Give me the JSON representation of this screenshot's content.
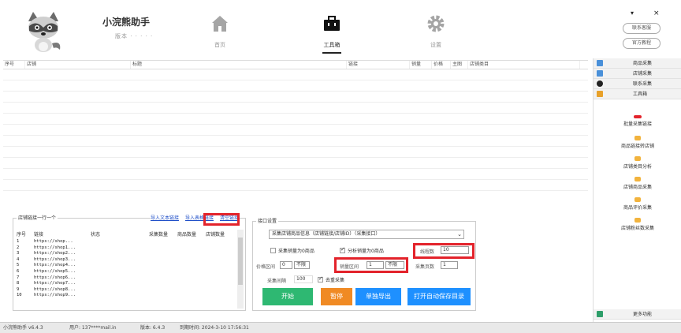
{
  "header": {
    "app_title": "小浣熊助手",
    "app_subtitle": "版本 · · · · ·",
    "nav": [
      {
        "label": "首页",
        "icon": "home-icon"
      },
      {
        "label": "工具箱",
        "icon": "toolbox-icon",
        "active": true
      },
      {
        "label": "设置",
        "icon": "gear-icon"
      }
    ],
    "right": {
      "minimize": "▾",
      "close": "×",
      "pill1": "联系客服",
      "pill2": "官方教程"
    }
  },
  "table": {
    "columns": [
      "序号",
      "店铺",
      "标题",
      "链接",
      "销量",
      "价格",
      "主图",
      "店铺类目"
    ]
  },
  "sidebar": {
    "items": [
      {
        "label": "商品采集",
        "icon": "chart-icon",
        "color": "#4a90d9"
      },
      {
        "label": "店铺采集",
        "icon": "grid-icon",
        "color": "#4a90d9"
      },
      {
        "label": "联系采集",
        "icon": "gender-icon",
        "color": "#222222"
      },
      {
        "label": "工具箱",
        "icon": "folder-icon",
        "color": "#e8a12a"
      }
    ],
    "sub_items": [
      "批量采集链接",
      "商品链接转店铺",
      "店铺类目分析",
      "店铺商品采集",
      "商品评价采集",
      "店铺粉丝数采集"
    ],
    "bottom_item": {
      "label": "更多功能",
      "icon": "search-icon"
    }
  },
  "links_panel": {
    "title": "店铺链接一行一个",
    "links": [
      "导入文本链接",
      "导入表格链接",
      "清空链接"
    ],
    "columns": [
      "序号",
      "链接",
      "状态",
      "采集数量",
      "商品数量",
      "店铺数量"
    ],
    "rows": [
      {
        "no": "1",
        "link": "https://shop..."
      },
      {
        "no": "2",
        "link": "https://shop1..."
      },
      {
        "no": "3",
        "link": "https://shop2..."
      },
      {
        "no": "4",
        "link": "https://shop3..."
      },
      {
        "no": "5",
        "link": "https://shop4..."
      },
      {
        "no": "6",
        "link": "https://shop5..."
      },
      {
        "no": "7",
        "link": "https://shop6..."
      },
      {
        "no": "8",
        "link": "https://shop7..."
      },
      {
        "no": "9",
        "link": "https://shop8..."
      },
      {
        "no": "10",
        "link": "https://shop9..."
      }
    ]
  },
  "interface_panel": {
    "title": "接口设置",
    "select_value": "采集店铺商品信息（店铺链接/店铺ID）（采集接口）",
    "cb1": "采集销量为0商品",
    "cb2": "分析销量为0商品",
    "thread_label": "线程数",
    "thread_value": "10",
    "price_label": "价格区间",
    "price_from": "0",
    "price_to": "不限",
    "sales_label": "销量区间",
    "sales_from": "1",
    "sales_to": "不限",
    "page_label": "采集页数",
    "page_value": "1",
    "interval_label": "采集间隔",
    "interval_value": "100",
    "cb3": "去重采集",
    "buttons": [
      {
        "label": "开始",
        "color": "#2eb872"
      },
      {
        "label": "暂停",
        "color": "#f08a24"
      },
      {
        "label": "单独导出",
        "color": "#1e90ff"
      },
      {
        "label": "打开自动保存目录",
        "color": "#1e90ff"
      }
    ]
  },
  "status_bar": {
    "version": "小浣熊助手 v6.4.3",
    "user": "用户: 137****mail.in",
    "build": "版本: 6.4.3",
    "expire": "到期时间: 2024-3-10 17:56:31"
  }
}
